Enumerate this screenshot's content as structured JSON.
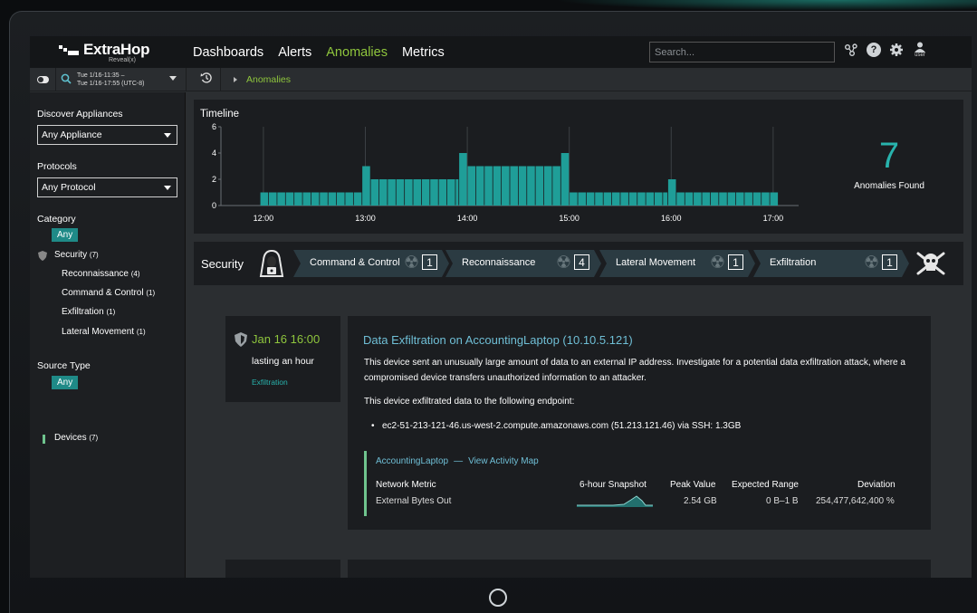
{
  "app": {
    "brand": "ExtraHop",
    "brand_sub": "Reveal(x)"
  },
  "nav": {
    "links": [
      "Dashboards",
      "Alerts",
      "Anomalies",
      "Metrics"
    ],
    "active": "Anomalies",
    "search_placeholder": "Search...",
    "user_label": "user"
  },
  "subbar": {
    "time_line1": "Tue 1/16-11:35 –",
    "time_line2": "Tue 1/16-17:55 (UTC-8)",
    "breadcrumb": "Anomalies"
  },
  "sidebar": {
    "appliances_heading": "Discover Appliances",
    "appliances_value": "Any Appliance",
    "protocols_heading": "Protocols",
    "protocols_value": "Any Protocol",
    "category_heading": "Category",
    "category_any": "Any",
    "category_security": "Security",
    "category_security_count": "(7)",
    "subcategories": [
      {
        "label": "Reconnaissance",
        "count": "(4)"
      },
      {
        "label": "Command & Control",
        "count": "(1)"
      },
      {
        "label": "Exfiltration",
        "count": "(1)"
      },
      {
        "label": "Lateral Movement",
        "count": "(1)"
      }
    ],
    "source_heading": "Source Type",
    "source_any": "Any",
    "source_devices": "Devices",
    "source_devices_count": "(7)"
  },
  "timeline": {
    "title": "Timeline",
    "count": "7",
    "count_label": "Anomalies Found",
    "accent": "#1f9e98"
  },
  "chart_data": {
    "type": "bar",
    "ylim": [
      0,
      6
    ],
    "yticks": [
      "0",
      "2",
      "4",
      "6"
    ],
    "xticks": [
      "12:00",
      "13:00",
      "14:00",
      "15:00",
      "16:00",
      "17:00"
    ],
    "step_minutes": 5,
    "segments": [
      {
        "start": "11:58",
        "end": "12:58",
        "value": 1
      },
      {
        "start": "12:58",
        "end": "13:03",
        "value": 3
      },
      {
        "start": "13:03",
        "end": "13:55",
        "value": 2
      },
      {
        "start": "13:55",
        "end": "14:00",
        "value": 4
      },
      {
        "start": "14:00",
        "end": "14:55",
        "value": 3
      },
      {
        "start": "14:55",
        "end": "15:00",
        "value": 4
      },
      {
        "start": "15:00",
        "end": "15:58",
        "value": 1
      },
      {
        "start": "15:58",
        "end": "16:03",
        "value": 2
      },
      {
        "start": "16:03",
        "end": "17:03",
        "value": 1
      }
    ]
  },
  "security": {
    "title": "Security",
    "stages": [
      {
        "label": "Command & Control",
        "count": "1"
      },
      {
        "label": "Reconnaissance",
        "count": "4"
      },
      {
        "label": "Lateral Movement",
        "count": "1"
      },
      {
        "label": "Exfiltration",
        "count": "1"
      }
    ]
  },
  "detail": {
    "date": "Jan 16 16:00",
    "duration": "lasting an hour",
    "category": "Exfiltration",
    "title": "Data Exfiltration on AccountingLaptop (10.10.5.121)",
    "description": "This device sent an unusually large amount of data to an external IP address. Investigate for a potential data exfiltration attack, where a compromised device transfers unauthorized information to an attacker.",
    "endpoint_intro": "This device exfiltrated data to the following endpoint:",
    "endpoint": "ec2-51-213-121-46.us-west-2.compute.amazonaws.com (51.213.121.46) via SSH: 1.3GB",
    "device_link": "AccountingLaptop",
    "link_sep": "—",
    "map_link": "View Activity Map",
    "headers": {
      "metric": "Network Metric",
      "snapshot": "6-hour Snapshot",
      "peak": "Peak Value",
      "range": "Expected Range",
      "deviation": "Deviation"
    },
    "row": {
      "metric": "External Bytes Out",
      "peak": "2.54 GB",
      "range": "0 B–1 B",
      "deviation": "254,477,642,400 %"
    }
  }
}
